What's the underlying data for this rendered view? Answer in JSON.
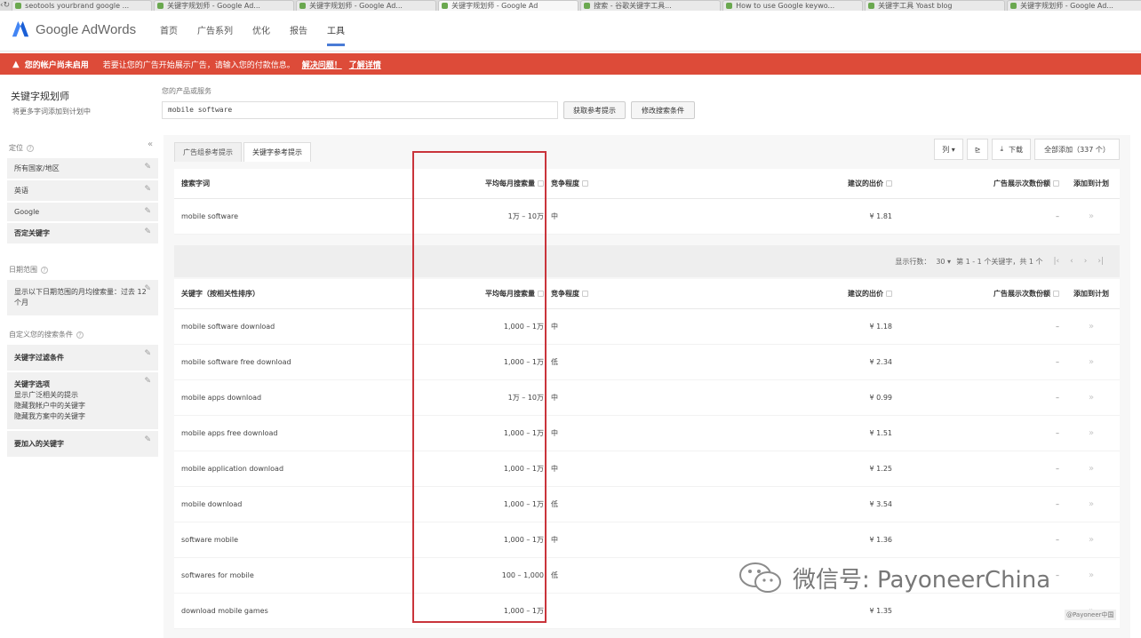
{
  "browser": {
    "tabs": [
      {
        "label": "seotools yourbrand google ..."
      },
      {
        "label": "关键字规划师 - Google Ad..."
      },
      {
        "label": "关键字规划师 - Google Ad..."
      },
      {
        "label": "关键字规划师 - Google Ad"
      },
      {
        "label": "搜索 - 谷歌关键字工具..."
      },
      {
        "label": "How to use Google keywo..."
      },
      {
        "label": "关键字工具 Yoast blog"
      },
      {
        "label": "关键字规划师 - Google Ad..."
      }
    ]
  },
  "header": {
    "logo_text": "Google AdWords",
    "nav": [
      "首页",
      "广告系列",
      "优化",
      "报告",
      "工具"
    ]
  },
  "alert": {
    "title": "您的帐户尚未启用",
    "message": "若要让您的广告开始展示广告，请输入您的付款信息。",
    "link1": "解决问题！",
    "link2": "了解详情"
  },
  "page": {
    "title": "关键字规划师",
    "subtitle": "将更多字词添加到计划中",
    "query_label": "您的产品或服务",
    "query_value": "mobile software",
    "btn_get": "获取参考提示",
    "btn_modify": "修改搜索条件"
  },
  "sidebar": {
    "targeting_head": "定位",
    "targeting": [
      "所有国家/地区",
      "英语",
      "Google",
      "否定关键字"
    ],
    "date_head": "日期范围",
    "date_text": [
      "显示以下日期范围的月均搜索量：过去 12 个月"
    ],
    "filter_head": "自定义您的搜索条件",
    "keyword_filter": "关键字过滤条件",
    "keyword_options_title": "关键字选项",
    "keyword_options": [
      "显示广泛相关的提示",
      "隐藏我帐户中的关键字",
      "隐藏我方案中的关键字"
    ],
    "include_keywords": "要加入的关键字"
  },
  "main": {
    "tabs": [
      "广告组参考提示",
      "关键字参考提示"
    ],
    "tools": {
      "chart": "列 ▾",
      "export_label": "下载",
      "add_all": "全部添加（337 个）"
    },
    "search_table": {
      "headers": {
        "kw": "搜索字词",
        "vol": "平均每月搜索量",
        "comp": "竞争程度",
        "bid": "建议的出价",
        "share": "广告展示次数份额",
        "add": "添加到计划"
      },
      "rows": [
        {
          "kw": "mobile software",
          "vol": "1万 – 10万",
          "comp": "中",
          "bid": "¥ 1.81",
          "share": "–"
        }
      ]
    },
    "pager": {
      "rows_label": "显示行数：",
      "rows_value": "30 ▾",
      "range": "第 1 - 1 个关键字，共 1 个"
    },
    "keyword_table": {
      "headers": {
        "kw": "关键字（按相关性排序）",
        "vol": "平均每月搜索量",
        "comp": "竞争程度",
        "bid": "建议的出价",
        "share": "广告展示次数份额",
        "add": "添加到计划"
      },
      "rows": [
        {
          "kw": "mobile software download",
          "vol": "1,000 – 1万",
          "comp": "中",
          "bid": "¥ 1.18",
          "share": "–"
        },
        {
          "kw": "mobile software free download",
          "vol": "1,000 – 1万",
          "comp": "低",
          "bid": "¥ 2.34",
          "share": "–"
        },
        {
          "kw": "mobile apps download",
          "vol": "1万 – 10万",
          "comp": "中",
          "bid": "¥ 0.99",
          "share": "–"
        },
        {
          "kw": "mobile apps free download",
          "vol": "1,000 – 1万",
          "comp": "中",
          "bid": "¥ 1.51",
          "share": "–"
        },
        {
          "kw": "mobile application download",
          "vol": "1,000 – 1万",
          "comp": "中",
          "bid": "¥ 1.25",
          "share": "–"
        },
        {
          "kw": "mobile download",
          "vol": "1,000 – 1万",
          "comp": "低",
          "bid": "¥ 3.54",
          "share": "–"
        },
        {
          "kw": "software mobile",
          "vol": "1,000 – 1万",
          "comp": "中",
          "bid": "¥ 1.36",
          "share": "–"
        },
        {
          "kw": "softwares for mobile",
          "vol": "100 – 1,000",
          "comp": "低",
          "bid": "",
          "share": "–"
        },
        {
          "kw": "download mobile games",
          "vol": "1,000 – 1万",
          "comp": "",
          "bid": "¥ 1.35",
          "share": ""
        }
      ]
    }
  },
  "watermark": {
    "text": "微信号: PayoneerChina",
    "small": "@Payoneer中国"
  },
  "colors": {
    "alert": "#dd4b39",
    "highlight": "#c9343b",
    "nav_active": "#4a7bd6"
  }
}
